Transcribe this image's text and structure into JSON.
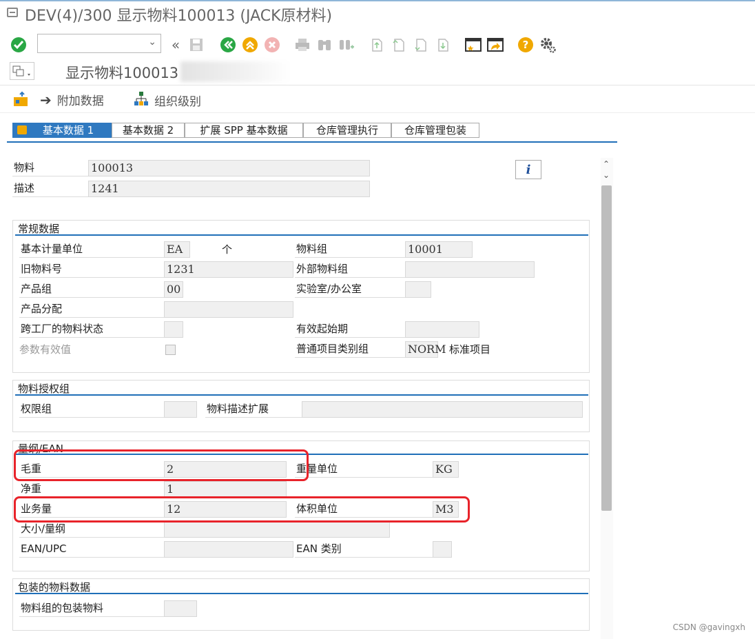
{
  "window": {
    "title": "DEV(4)/300 显示物料100013 (JACK原材料)"
  },
  "command": {
    "value": ""
  },
  "screen": {
    "title": "显示物料100013"
  },
  "app_toolbar": {
    "additional_data": "附加数据",
    "org_levels": "组织级别"
  },
  "tabs": [
    "基本数据 1",
    "基本数据 2",
    "扩展 SPP 基本数据",
    "仓库管理执行",
    "仓库管理包装"
  ],
  "header": {
    "material_label": "物料",
    "material_value": "100013",
    "desc_label": "描述",
    "desc_value": "1241"
  },
  "general": {
    "title": "常规数据",
    "base_uom_label": "基本计量单位",
    "base_uom_value": "EA",
    "base_uom_text": "个",
    "matl_group_label": "物料组",
    "matl_group_value": "10001",
    "old_matl_label": "旧物料号",
    "old_matl_value": "1231",
    "ext_matl_group_label": "外部物料组",
    "ext_matl_group_value": "",
    "division_label": "产品组",
    "division_value": "00",
    "lab_office_label": "实验室/办公室",
    "lab_office_value": "",
    "prod_alloc_label": "产品分配",
    "prod_alloc_value": "",
    "xplant_status_label": "跨工厂的物料状态",
    "xplant_status_value": "",
    "valid_from_label": "有效起始期",
    "valid_from_value": "",
    "param_eff_label": "参数有效值",
    "gen_item_cat_label": "普通项目类别组",
    "gen_item_cat_value": "NORM",
    "gen_item_cat_text": "标准项目"
  },
  "auth": {
    "title": "物料授权组",
    "auth_group_label": "权限组",
    "auth_group_value": "",
    "desc_ext_label": "物料描述扩展",
    "desc_ext_value": ""
  },
  "dims": {
    "title": "量纲/EAN",
    "gross_weight_label": "毛重",
    "gross_weight_value": "2",
    "weight_unit_label": "重量单位",
    "weight_unit_value": "KG",
    "net_weight_label": "净重",
    "net_weight_value": "1",
    "volume_label": "业务量",
    "volume_value": "12",
    "volume_unit_label": "体积单位",
    "volume_unit_value": "M3",
    "size_label": "大小/量纲",
    "size_value": "",
    "ean_label": "EAN/UPC",
    "ean_value": "",
    "ean_cat_label": "EAN 类别",
    "ean_cat_value": ""
  },
  "packaging": {
    "title": "包装的物料数据",
    "pack_group_label": "物料组的包装物料",
    "pack_group_value": ""
  },
  "watermark": "CSDN @gavingxh",
  "colors": {
    "accent": "#1f6fb8",
    "highlight": "#e8232a",
    "field_bg": "#f0f0f0"
  }
}
